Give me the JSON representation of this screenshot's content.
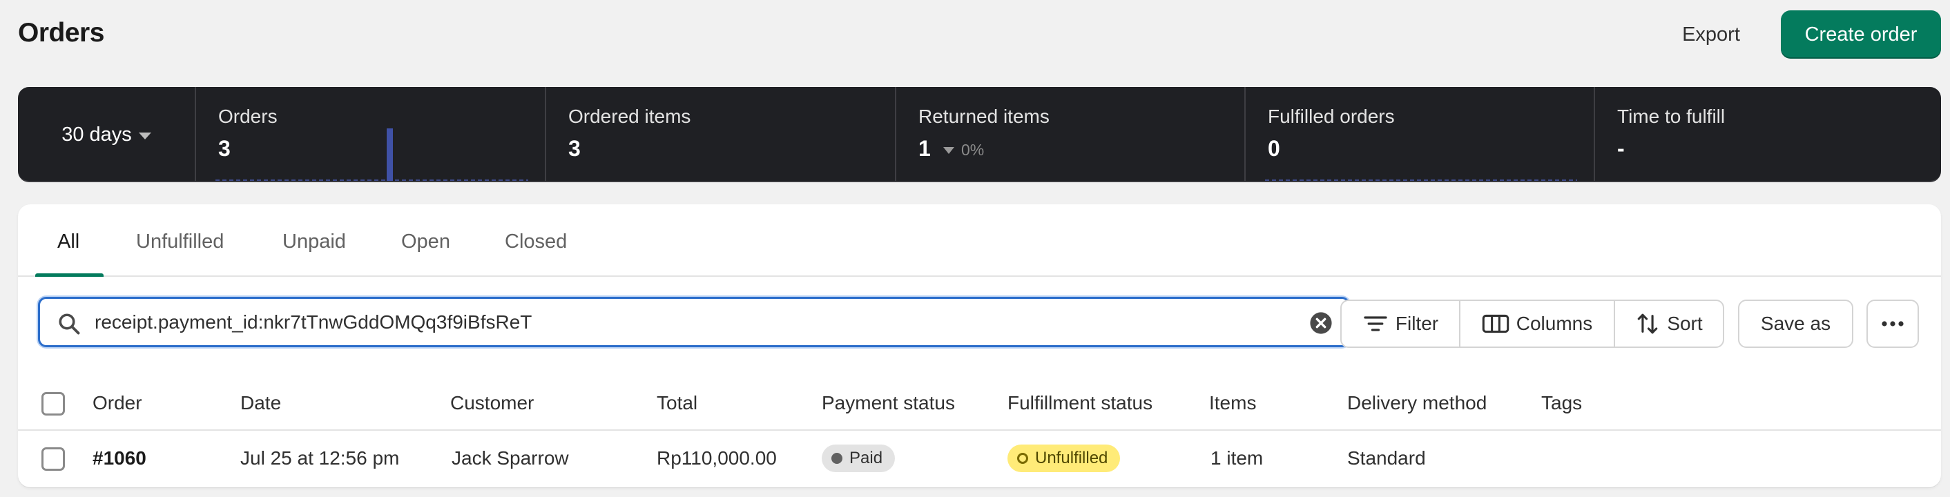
{
  "page": {
    "title": "Orders"
  },
  "actions": {
    "export": "Export",
    "create": "Create order"
  },
  "colors": {
    "primary": "#047b5d",
    "metrics_bg": "#1f2024",
    "focus": "#2c6ecb",
    "paid_badge": "#e3e3e3",
    "unfulfilled_badge": "#ffeb78"
  },
  "metrics": {
    "period": "30 days",
    "items": [
      {
        "label": "Orders",
        "value": "3"
      },
      {
        "label": "Ordered items",
        "value": "3"
      },
      {
        "label": "Returned items",
        "value": "1",
        "change": "0%"
      },
      {
        "label": "Fulfilled orders",
        "value": "0"
      },
      {
        "label": "Time to fulfill",
        "value": "-"
      }
    ]
  },
  "tabs": [
    "All",
    "Unfulfilled",
    "Unpaid",
    "Open",
    "Closed"
  ],
  "search": {
    "value": "receipt.payment_id:nkr7tTnwGddOMQq3f9iBfsReT",
    "icon": "search-icon",
    "clear_icon": "clear-icon"
  },
  "toolbar": {
    "filter": "Filter",
    "columns": "Columns",
    "sort": "Sort",
    "save_as": "Save as",
    "more_icon": "more-icon"
  },
  "table": {
    "columns": [
      "Order",
      "Date",
      "Customer",
      "Total",
      "Payment status",
      "Fulfillment status",
      "Items",
      "Delivery method",
      "Tags"
    ],
    "rows": [
      {
        "order": "#1060",
        "date": "Jul 25 at 12:56 pm",
        "customer": "Jack Sparrow",
        "total": "Rp110,000.00",
        "payment_status": "Paid",
        "fulfillment_status": "Unfulfilled",
        "items": "1 item",
        "delivery_method": "Standard",
        "tags": ""
      }
    ]
  }
}
